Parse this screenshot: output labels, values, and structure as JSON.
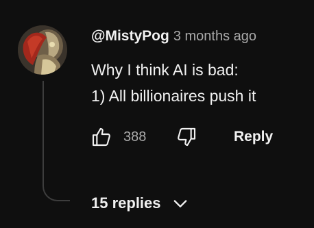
{
  "comment": {
    "author": "@MistyPog",
    "timestamp": "3 months ago",
    "text_lines": [
      "Why I think AI is bad:",
      "1) All billionaires push it"
    ],
    "like_count": "388",
    "reply_label": "Reply",
    "replies_label": "15 replies"
  },
  "icons": {
    "like": "thumbs-up-icon",
    "dislike": "thumbs-down-icon",
    "expand": "chevron-down-icon"
  },
  "colors": {
    "background": "#0f0f0f",
    "primary_text": "#f1f1f1",
    "secondary_text": "#aaaaaa",
    "thread_line": "#3d3d3d"
  }
}
